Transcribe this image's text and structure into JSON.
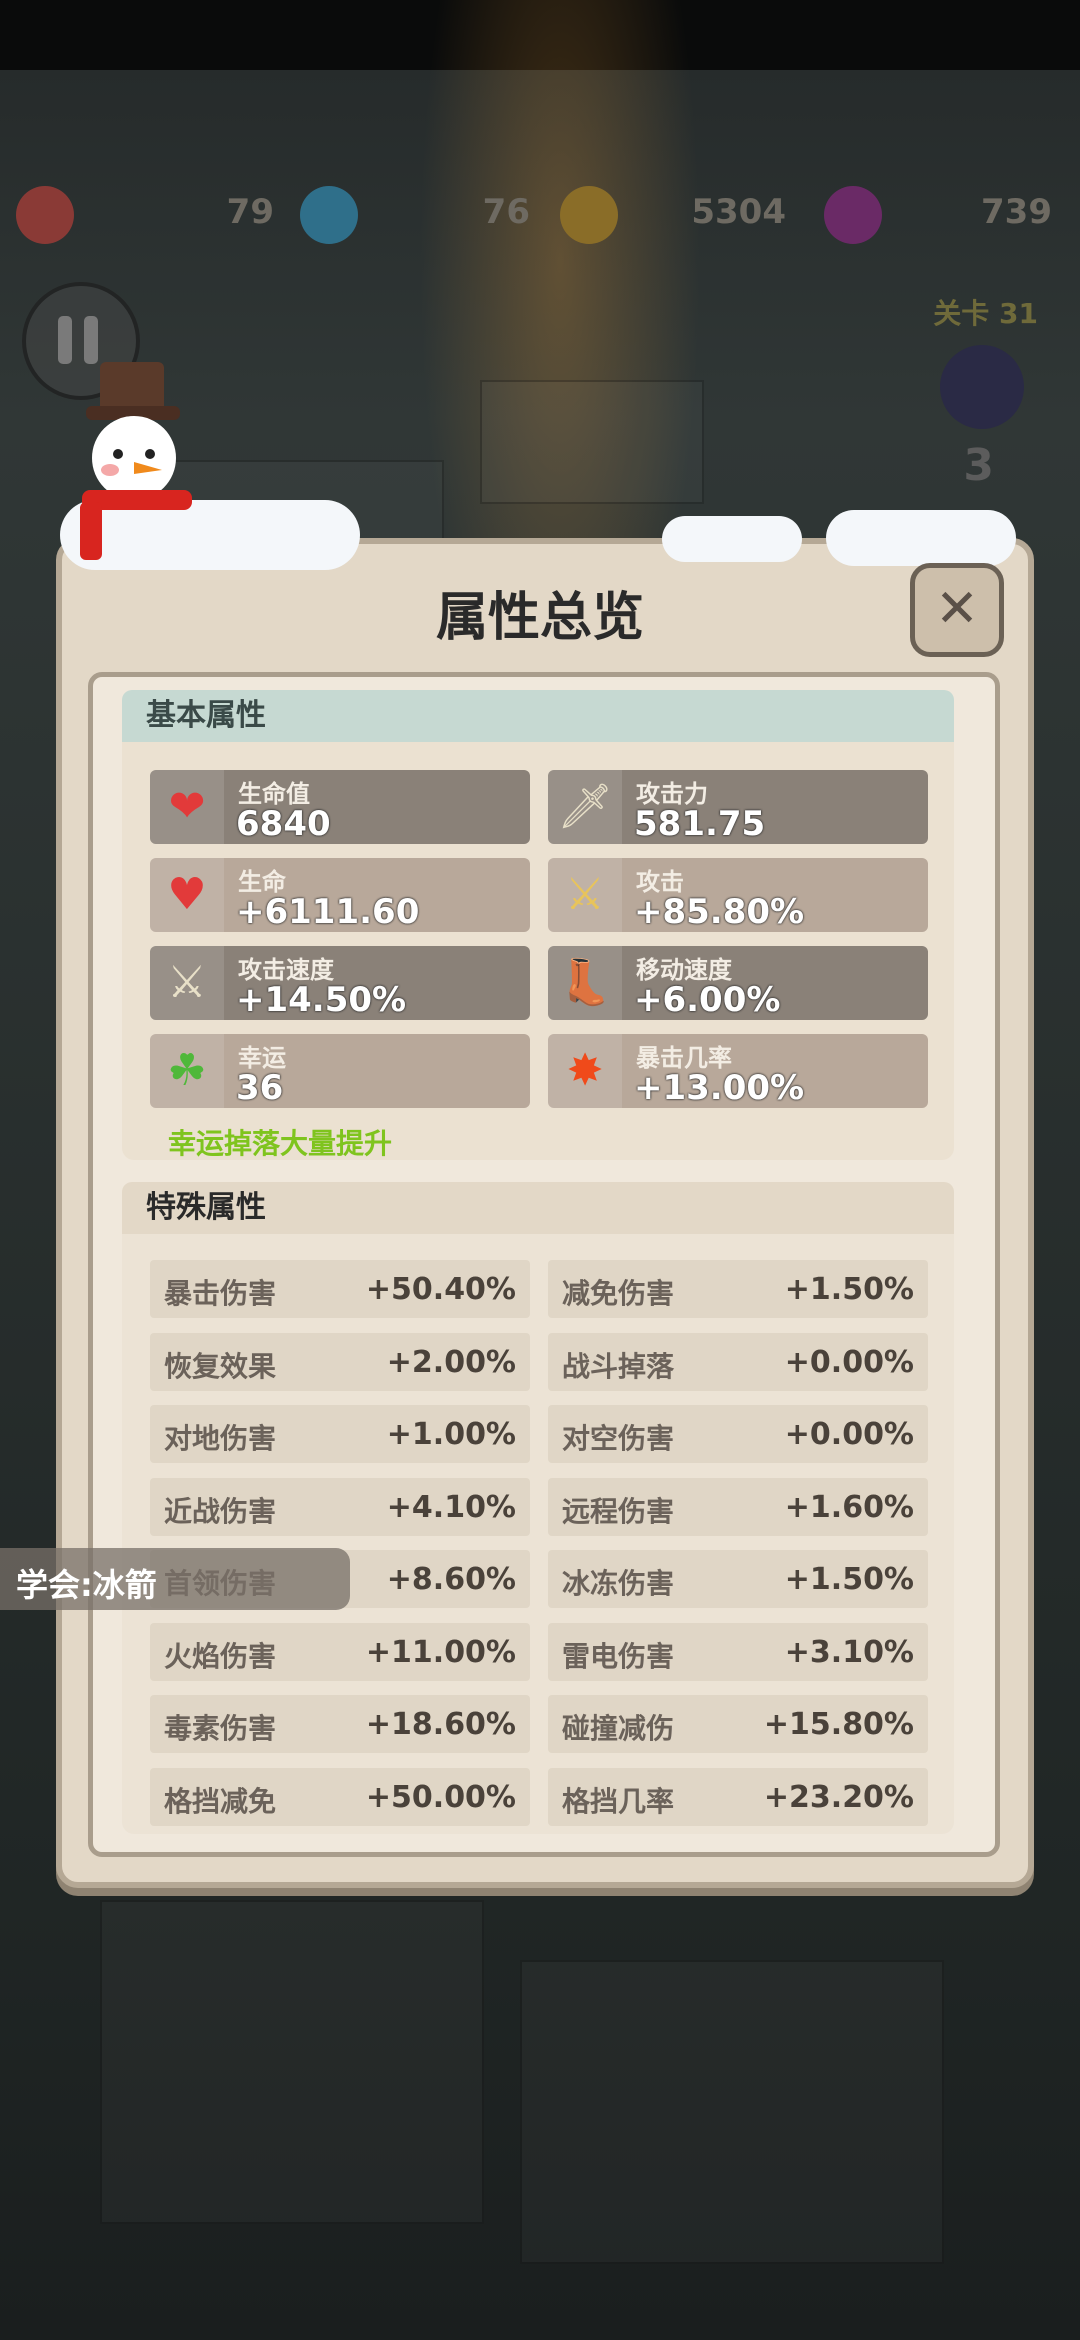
{
  "hud": {
    "items": [
      {
        "icon": "red-gem-icon",
        "value": "79"
      },
      {
        "icon": "blue-orb-icon",
        "value": "76"
      },
      {
        "icon": "gold-coin-icon",
        "value": "5304"
      },
      {
        "icon": "purple-crystal-icon",
        "value": "739"
      }
    ],
    "stage": "关卡 31",
    "enemy_count": "3"
  },
  "dialog": {
    "title": "属性总览",
    "close": "✕",
    "basic": {
      "header": "基本属性",
      "stats": [
        {
          "name": "生命值",
          "value": "6840",
          "icon": "heart-icon",
          "tone": "dark"
        },
        {
          "name": "攻击力",
          "value": "581.75",
          "icon": "sword-icon",
          "tone": "dark"
        },
        {
          "name": "生命",
          "value": "+6111.60",
          "icon": "heart-up-icon",
          "tone": "light"
        },
        {
          "name": "攻击",
          "value": "+85.80%",
          "icon": "sword-gold-icon",
          "tone": "light"
        },
        {
          "name": "攻击速度",
          "value": "+14.50%",
          "icon": "winged-sword-icon",
          "tone": "dark"
        },
        {
          "name": "移动速度",
          "value": "+6.00%",
          "icon": "winged-boot-icon",
          "tone": "dark"
        },
        {
          "name": "幸运",
          "value": "36",
          "icon": "clover-icon",
          "tone": "light"
        },
        {
          "name": "暴击几率",
          "value": "+13.00%",
          "icon": "explosion-icon",
          "tone": "light"
        }
      ],
      "note": "幸运掉落大量提升"
    },
    "special": {
      "header": "特殊属性",
      "rows": [
        [
          {
            "k": "暴击伤害",
            "v": "+50.40%"
          },
          {
            "k": "减免伤害",
            "v": "+1.50%"
          }
        ],
        [
          {
            "k": "恢复效果",
            "v": "+2.00%"
          },
          {
            "k": "战斗掉落",
            "v": "+0.00%"
          }
        ],
        [
          {
            "k": "对地伤害",
            "v": "+1.00%"
          },
          {
            "k": "对空伤害",
            "v": "+0.00%"
          }
        ],
        [
          {
            "k": "近战伤害",
            "v": "+4.10%"
          },
          {
            "k": "远程伤害",
            "v": "+1.60%"
          }
        ],
        [
          {
            "k": "首领伤害",
            "v": "+8.60%"
          },
          {
            "k": "冰冻伤害",
            "v": "+1.50%"
          }
        ],
        [
          {
            "k": "火焰伤害",
            "v": "+11.00%"
          },
          {
            "k": "雷电伤害",
            "v": "+3.10%"
          }
        ],
        [
          {
            "k": "毒素伤害",
            "v": "+18.60%"
          },
          {
            "k": "碰撞减伤",
            "v": "+15.80%"
          }
        ],
        [
          {
            "k": "格挡减免",
            "v": "+50.00%"
          },
          {
            "k": "格挡几率",
            "v": "+23.20%"
          }
        ]
      ]
    }
  },
  "toast": "学会:冰箭",
  "colors": {
    "note_green": "#7fc41e",
    "basic_header": "#c6d9d2",
    "special_header": "#e3d8c7"
  }
}
